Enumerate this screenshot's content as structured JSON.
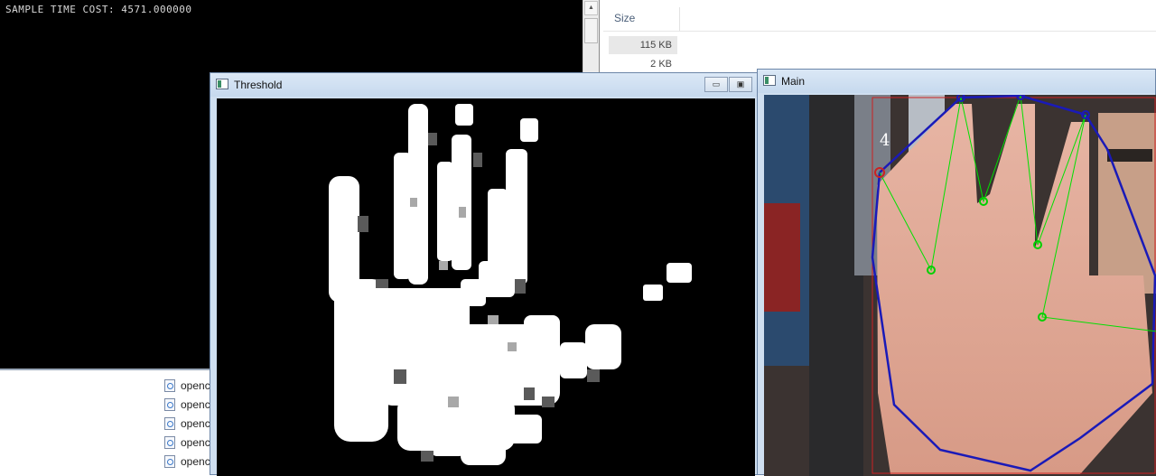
{
  "explorer": {
    "size_header": "Size",
    "sizes": [
      "115 KB",
      "2 KB"
    ],
    "files": [
      "openc",
      "openc",
      "openc",
      "openc",
      "openc"
    ]
  },
  "console": {
    "output_text": "SAMPLE TIME COST: 4571.000000",
    "scroll_up": "▲"
  },
  "threshold_window": {
    "title": "Threshold",
    "minimize": "▭",
    "restore": "▣"
  },
  "main_window": {
    "title": "Main",
    "finger_count": "4"
  },
  "colors": {
    "hull": "#1a1ab8",
    "defects": "#00e000",
    "roi": "#cc2222"
  }
}
